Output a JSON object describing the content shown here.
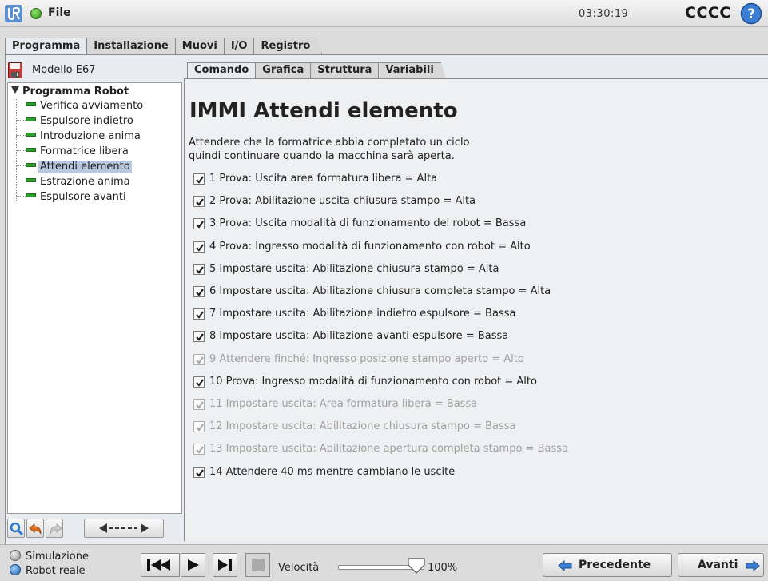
{
  "topbar": {
    "file_label": "File",
    "clock": "03:30:19",
    "robot_name": "CCCC",
    "help_glyph": "?",
    "logo_icon": "ur-logo-icon",
    "status_icon": "status-green-icon"
  },
  "main_tabs": [
    {
      "label": "Programma",
      "active": true
    },
    {
      "label": "Installazione",
      "active": false
    },
    {
      "label": "Muovi",
      "active": false
    },
    {
      "label": "I/O",
      "active": false
    },
    {
      "label": "Registro",
      "active": false
    }
  ],
  "program": {
    "model_name": "Modello E67"
  },
  "tree": {
    "root_label": "Programma Robot",
    "items": [
      {
        "label": "Verifica avviamento",
        "selected": false
      },
      {
        "label": "Espulsore indietro",
        "selected": false
      },
      {
        "label": "Introduzione anima",
        "selected": false
      },
      {
        "label": "Formatrice libera",
        "selected": false
      },
      {
        "label": "Attendi elemento",
        "selected": true
      },
      {
        "label": "Estrazione anima",
        "selected": false
      },
      {
        "label": "Espulsore avanti",
        "selected": false
      }
    ]
  },
  "sub_tabs": [
    {
      "label": "Comando",
      "active": true
    },
    {
      "label": "Grafica",
      "active": false
    },
    {
      "label": "Struttura",
      "active": false
    },
    {
      "label": "Variabili",
      "active": false
    }
  ],
  "content": {
    "title": "IMMI Attendi elemento",
    "description_line1": "Attendere che la formatrice abbia completato un ciclo",
    "description_line2": "quindi continuare quando la macchina sarà aperta.",
    "steps": [
      {
        "text": "1 Prova: Uscita area formatura libera = Alta",
        "checked": true,
        "enabled": true
      },
      {
        "text": "2 Prova: Abilitazione uscita chiusura stampo = Alta",
        "checked": true,
        "enabled": true
      },
      {
        "text": "3 Prova: Uscita modalità di funzionamento del robot = Bassa",
        "checked": true,
        "enabled": true
      },
      {
        "text": "4 Prova: Ingresso modalità di funzionamento con robot = Alto",
        "checked": true,
        "enabled": true
      },
      {
        "text": "5 Impostare uscita: Abilitazione chiusura stampo = Alta",
        "checked": true,
        "enabled": true
      },
      {
        "text": "6 Impostare uscita: Abilitazione chiusura completa stampo = Alta",
        "checked": true,
        "enabled": true
      },
      {
        "text": "7 Impostare uscita: Abilitazione indietro espulsore = Bassa",
        "checked": true,
        "enabled": true
      },
      {
        "text": "8 Impostare uscita: Abilitazione avanti espulsore = Bassa",
        "checked": true,
        "enabled": true
      },
      {
        "text": "9 Attendere finché: Ingresso posizione stampo aperto = Alto",
        "checked": true,
        "enabled": false
      },
      {
        "text": "10 Prova: Ingresso modalità di funzionamento con robot = Alto",
        "checked": true,
        "enabled": true
      },
      {
        "text": "11 Impostare uscita: Area formatura libera = Bassa",
        "checked": true,
        "enabled": false
      },
      {
        "text": "12 Impostare uscita: Abilitazione chiusura stampo = Bassa",
        "checked": true,
        "enabled": false
      },
      {
        "text": "13 Impostare uscita: Abilitazione apertura completa stampo = Bassa",
        "checked": true,
        "enabled": false
      },
      {
        "text": "14 Attendere 40 ms mentre cambiano le uscite",
        "checked": true,
        "enabled": true
      }
    ]
  },
  "bottombar": {
    "mode_simulation": "Simulazione",
    "mode_real": "Robot reale",
    "mode_selected": "Robot reale",
    "speed_label": "Velocità",
    "speed_value": "100%",
    "speed_fraction": 1.0,
    "prev_label": "Precedente",
    "next_label": "Avanti"
  },
  "colors": {
    "accent_blue": "#2a78d0",
    "node_green": "#2d9e2d",
    "disabled_text": "#a0a0a0"
  }
}
